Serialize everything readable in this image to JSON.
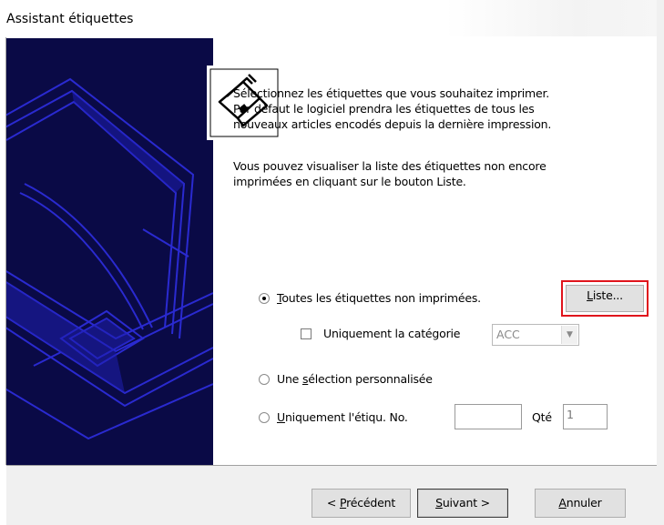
{
  "window": {
    "title": "Assistant étiquettes"
  },
  "intro": {
    "line1": "Sélectionnez les étiquettes que vous souhaitez imprimer.",
    "line2": "Par défaut le logiciel prendra les étiquettes de tous les",
    "line3": "nouveaux articles encodés depuis la dernière impression.",
    "line4": "Vous pouvez visualiser la liste des étiquettes non encore",
    "line5": "imprimées en cliquant sur le bouton Liste."
  },
  "options": {
    "all_unprinted": {
      "hotkey": "T",
      "label_rest": "outes les étiquettes non imprimées.",
      "checked": true
    },
    "list_button": {
      "hotkey": "L",
      "label_rest": "iste..."
    },
    "category_only": {
      "label": "Uniquement la catégorie",
      "checked": false,
      "category_value": "ACC"
    },
    "custom_selection": {
      "label_pre": "Une ",
      "hotkey": "s",
      "label_rest": "élection personnalisée",
      "checked": false
    },
    "label_only": {
      "hotkey": "U",
      "label_rest": "niquement l'étiqu. No.",
      "checked": false,
      "number_value": "",
      "qty_label": "Qté",
      "qty_value": "1"
    }
  },
  "footer": {
    "prev": {
      "pre": "< ",
      "hotkey": "P",
      "rest": "récédent"
    },
    "next": {
      "hotkey": "S",
      "rest": "uivant >"
    },
    "cancel": {
      "hotkey": "A",
      "rest": "nnuler"
    }
  },
  "colors": {
    "sidebar_bg": "#0a0a46",
    "sidebar_stroke": "#2a2ad0",
    "highlight": "#e0141c"
  },
  "icons": {
    "wizard_icon": "printer-label-icon"
  }
}
